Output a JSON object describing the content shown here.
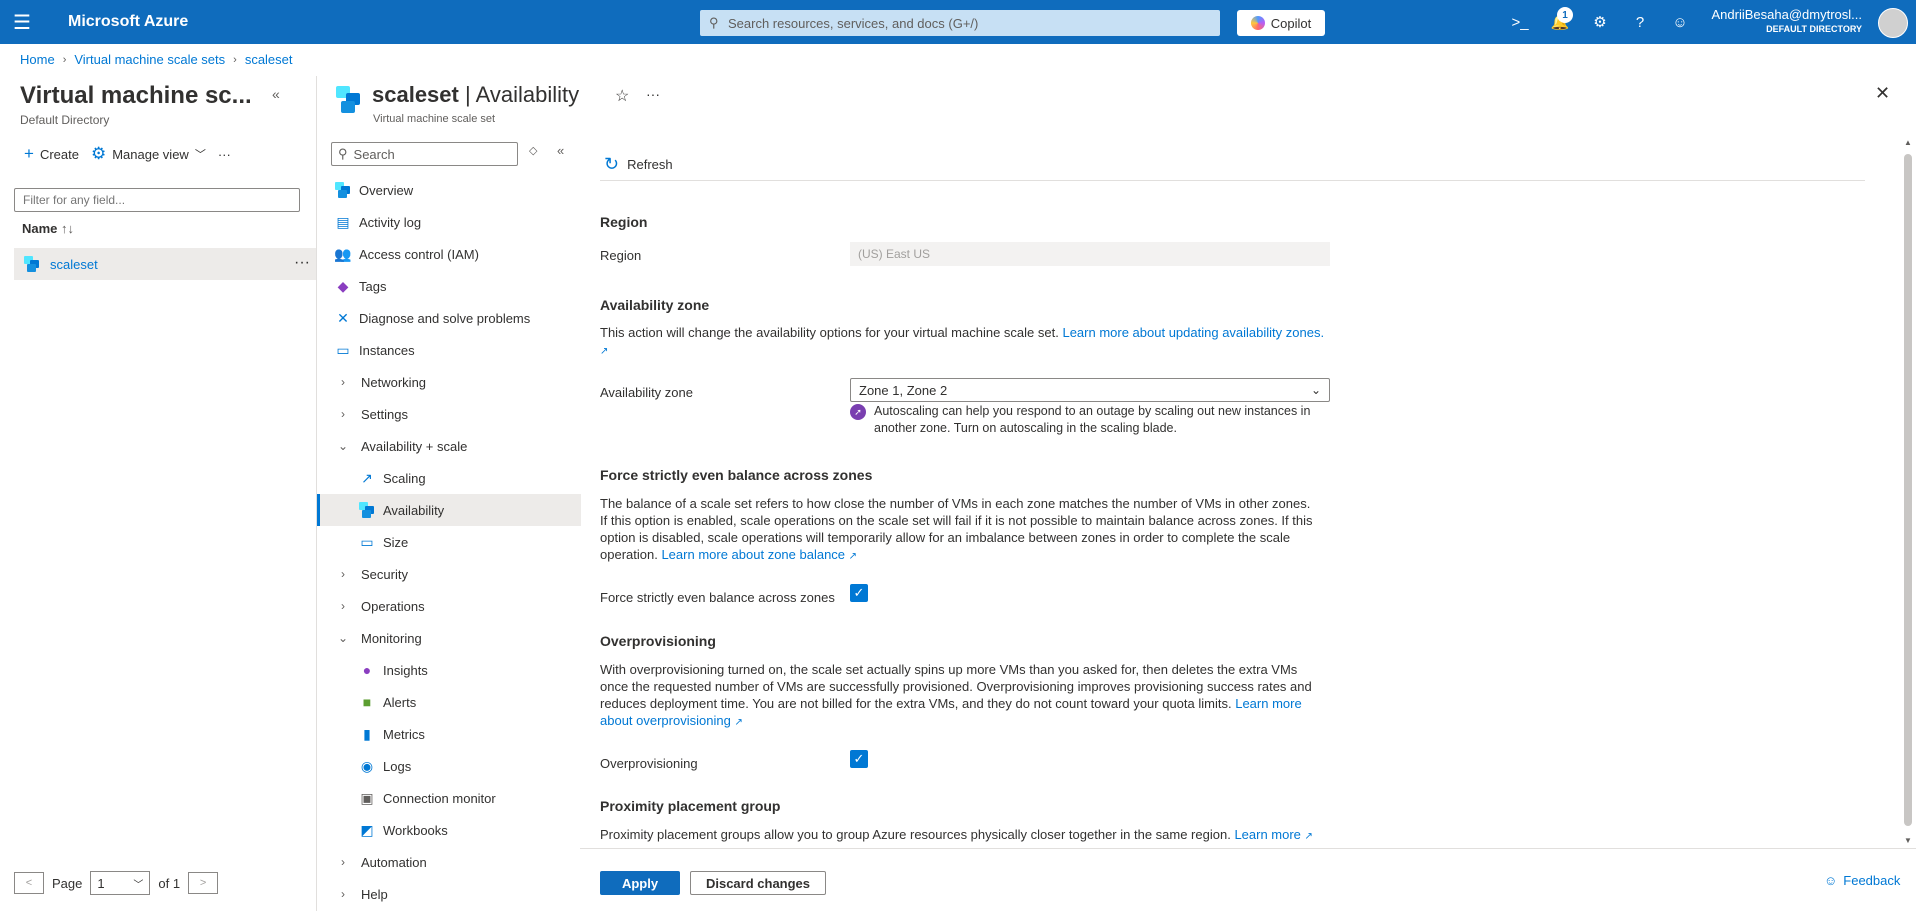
{
  "topbar": {
    "brand": "Microsoft Azure",
    "search_placeholder": "Search resources, services, and docs (G+/)",
    "copilot_label": "Copilot",
    "notification_count": "1",
    "user_name": "AndriiBesaha@dmytrosl...",
    "user_directory": "DEFAULT DIRECTORY"
  },
  "breadcrumb": [
    "Home",
    "Virtual machine scale sets",
    "scaleset"
  ],
  "left_pane": {
    "title": "Virtual machine sc...",
    "subtitle": "Default Directory",
    "create_label": "Create",
    "manage_view_label": "Manage view",
    "filter_placeholder": "Filter for any field...",
    "column_name": "Name",
    "items": [
      {
        "name": "scaleset"
      }
    ],
    "pager": {
      "page_label": "Page",
      "current_page": "1",
      "of_label": "of 1"
    }
  },
  "resource": {
    "name": "scaleset",
    "page": "Availability",
    "type": "Virtual machine scale set",
    "menu_search_placeholder": "Search"
  },
  "menu": [
    {
      "label": "Overview"
    },
    {
      "label": "Activity log"
    },
    {
      "label": "Access control (IAM)"
    },
    {
      "label": "Tags"
    },
    {
      "label": "Diagnose and solve problems"
    },
    {
      "label": "Instances"
    },
    {
      "label": "Networking"
    },
    {
      "label": "Settings"
    },
    {
      "label": "Availability + scale"
    },
    {
      "label": "Scaling"
    },
    {
      "label": "Availability"
    },
    {
      "label": "Size"
    },
    {
      "label": "Security"
    },
    {
      "label": "Operations"
    },
    {
      "label": "Monitoring"
    },
    {
      "label": "Insights"
    },
    {
      "label": "Alerts"
    },
    {
      "label": "Metrics"
    },
    {
      "label": "Logs"
    },
    {
      "label": "Connection monitor"
    },
    {
      "label": "Workbooks"
    },
    {
      "label": "Automation"
    },
    {
      "label": "Help"
    }
  ],
  "content": {
    "refresh_label": "Refresh",
    "region": {
      "section": "Region",
      "label": "Region",
      "value": "(US) East US"
    },
    "availability_zone": {
      "section": "Availability zone",
      "description": "This action will change the availability options for your virtual machine scale set.",
      "link": "Learn more about updating availability zones.",
      "label": "Availability zone",
      "value": "Zone 1, Zone 2",
      "info": "Autoscaling can help you respond to an outage by scaling out new instances in another zone. Turn on autoscaling in the scaling blade."
    },
    "balance": {
      "section": "Force strictly even balance across zones",
      "description": "The balance of a scale set refers to how close the number of VMs in each zone matches the number of VMs in other zones. If this option is enabled, scale operations on the scale set will fail if it is not possible to maintain balance across zones. If this option is disabled, scale operations will temporarily allow for an imbalance between zones in order to complete the scale operation.",
      "link": "Learn more about zone balance",
      "label": "Force strictly even balance across zones",
      "checked": true
    },
    "overprovisioning": {
      "section": "Overprovisioning",
      "description": "With overprovisioning turned on, the scale set actually spins up more VMs than you asked for, then deletes the extra VMs once the requested number of VMs are successfully provisioned. Overprovisioning improves provisioning success rates and reduces deployment time. You are not billed for the extra VMs, and they do not count toward your quota limits.",
      "link": "Learn more about overprovisioning",
      "label": "Overprovisioning",
      "checked": true
    },
    "proximity": {
      "section": "Proximity placement group",
      "description": "Proximity placement groups allow you to group Azure resources physically closer together in the same region.",
      "link": "Learn more"
    }
  },
  "footer": {
    "apply_label": "Apply",
    "discard_label": "Discard changes",
    "feedback_label": "Feedback"
  },
  "colors": {
    "topbar": "#0f6cbd",
    "accent": "#0078d4",
    "selected_row": "#edebe9"
  }
}
